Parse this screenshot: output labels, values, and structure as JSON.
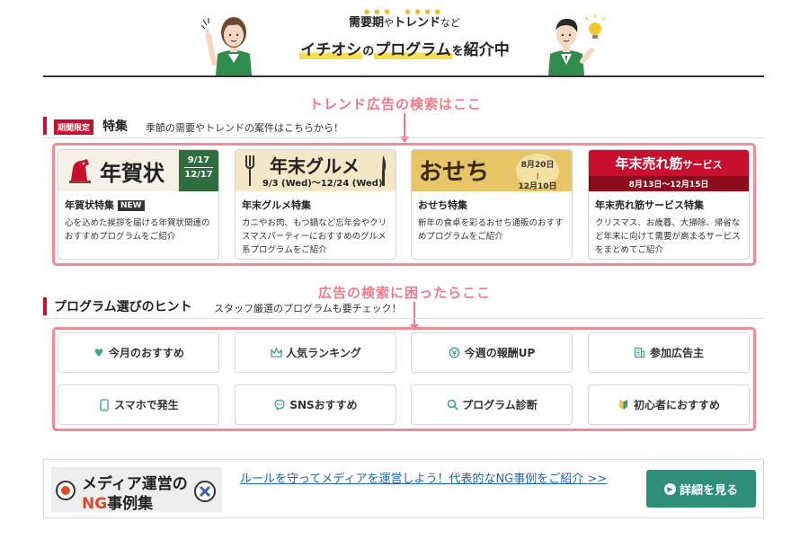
{
  "banner": {
    "line1_main": "需要期",
    "line1_small1": "や",
    "line1_mid": "トレンド",
    "line1_small2": "など",
    "line2_hl": "イチオシ",
    "line2_small1": "の",
    "line2_hl2": "プログラム",
    "line2_small2": "を",
    "line2_end": "紹介中"
  },
  "annotations": {
    "trend": "トレンド広告の検索はここ",
    "trouble": "広告の検索に困ったらここ"
  },
  "feature_section": {
    "tag": "期間限定",
    "title": "特集",
    "desc": "季節の需要やトレンドの案件はこちらから！"
  },
  "cards": [
    {
      "thumb_label": "年賀状",
      "thumb_date_top": "9/17",
      "thumb_date_bottom": "12/17",
      "title": "年賀状特集",
      "badge": "NEW",
      "desc": "心を込めた挨拶を届ける年賀状関連のおすすめプログラムをご紹介"
    },
    {
      "thumb_label": "年末グルメ",
      "thumb_date": "9/3 (Wed)～12/24 (Wed)",
      "title": "年末グルメ特集",
      "desc": "カニやお肉、もつ鍋など忘年会やクリスマスパーティーにおすすめのグルメ系プログラムをご紹介"
    },
    {
      "thumb_label": "おせち",
      "thumb_date_top": "8月20日",
      "thumb_date_bottom": "12月10日",
      "title": "おせち特集",
      "desc": "新年の食卓を彩るおせち通販のおすすめプログラムをご紹介"
    },
    {
      "thumb_label_main": "年末売れ筋",
      "thumb_label_small": "サービス",
      "thumb_date": "8月13日～12月15日",
      "title": "年末売れ筋サービス特集",
      "desc": "クリスマス、お歳暮、大掃除、帰省など年末に向けて需要が高まるサービスをまとめてご紹介"
    }
  ],
  "hint_section": {
    "title": "プログラム選びのヒント",
    "desc": "スタッフ厳選のプログラムも要チェック！"
  },
  "hints": [
    {
      "label": "今月のおすすめ",
      "icon": "heart-icon"
    },
    {
      "label": "人気ランキング",
      "icon": "crown-icon"
    },
    {
      "label": "今週の報酬UP",
      "icon": "coin-icon"
    },
    {
      "label": "参加広告主",
      "icon": "building-icon"
    },
    {
      "label": "スマホで発生",
      "icon": "smartphone-icon"
    },
    {
      "label": "SNSおすすめ",
      "icon": "chat-icon"
    },
    {
      "label": "プログラム診断",
      "icon": "search-icon"
    },
    {
      "label": "初心者におすすめ",
      "icon": "beginner-icon"
    }
  ],
  "promo": {
    "logo_line1": "メディア運営の",
    "logo_ng": "NG",
    "logo_line2_rest": "事例集",
    "link": "ルールを守ってメディアを運営しよう！代表的なNG事例をご紹介 >>",
    "button": "詳細を見る"
  },
  "colors": {
    "accent_red": "#c8102e",
    "annotation_pink": "#f07a8a",
    "button_green": "#2e8f78",
    "link_blue": "#1d65b4"
  }
}
